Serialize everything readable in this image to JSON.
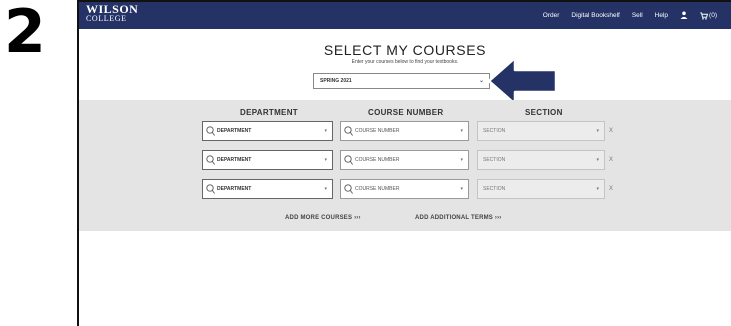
{
  "step_number": "2",
  "header": {
    "logo_line1": "WILSON",
    "logo_line2": "COLLEGE",
    "nav": [
      "Order",
      "Digital Bookshelf",
      "Sell",
      "Help"
    ],
    "cart_label": "(0)"
  },
  "main": {
    "title": "SELECT MY COURSES",
    "subtitle": "Enter your courses below to find your textbooks.",
    "term_value": "SPRING 2021",
    "columns": [
      "DEPARTMENT",
      "COURSE NUMBER",
      "SECTION"
    ],
    "rows": [
      {
        "department": "DEPARTMENT",
        "course": "COURSE NUMBER",
        "section": "SECTION",
        "remove": "X"
      },
      {
        "department": "DEPARTMENT",
        "course": "COURSE NUMBER",
        "section": "SECTION",
        "remove": "X"
      },
      {
        "department": "DEPARTMENT",
        "course": "COURSE NUMBER",
        "section": "SECTION",
        "remove": "X"
      }
    ],
    "add_more": "ADD MORE COURSES ›››",
    "add_terms": "ADD ADDITIONAL TERMS ›››"
  },
  "colors": {
    "navbar": "#243266",
    "arrow": "#243266",
    "panel": "#e4e4e4"
  },
  "icons": [
    "user-icon",
    "cart-icon",
    "search-icon",
    "chevron-down-icon",
    "arrow-left-icon"
  ]
}
